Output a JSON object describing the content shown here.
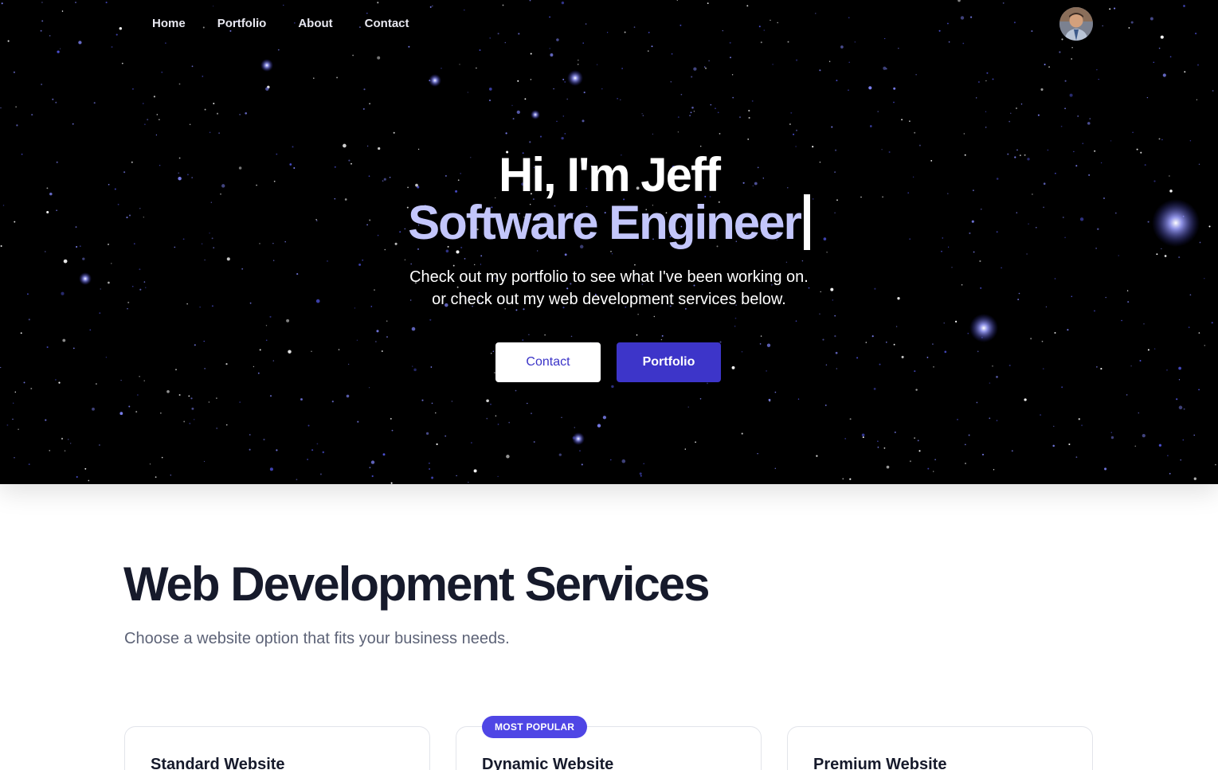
{
  "nav": {
    "items": [
      {
        "label": "Home"
      },
      {
        "label": "Portfolio"
      },
      {
        "label": "About"
      },
      {
        "label": "Contact"
      }
    ]
  },
  "hero": {
    "title": "Hi, I'm Jeff",
    "role": "Software Engineer",
    "subtitle_line1": "Check out my portfolio to see what I've been working on.",
    "subtitle_line2": "or check out my web development services below.",
    "contact_label": "Contact",
    "portfolio_label": "Portfolio"
  },
  "services": {
    "title": "Web Development Services",
    "subtitle": "Choose a website option that fits your business needs.",
    "badge": "MOST POPULAR",
    "cards": [
      {
        "title": "Standard Website"
      },
      {
        "title": "Dynamic Website"
      },
      {
        "title": "Premium Website"
      }
    ]
  },
  "colors": {
    "hero_bg": "#000000",
    "accent": "#3d35c9",
    "role_text": "#c3c6fb",
    "badge_bg": "#4f46e5",
    "heading": "#161a2b"
  }
}
